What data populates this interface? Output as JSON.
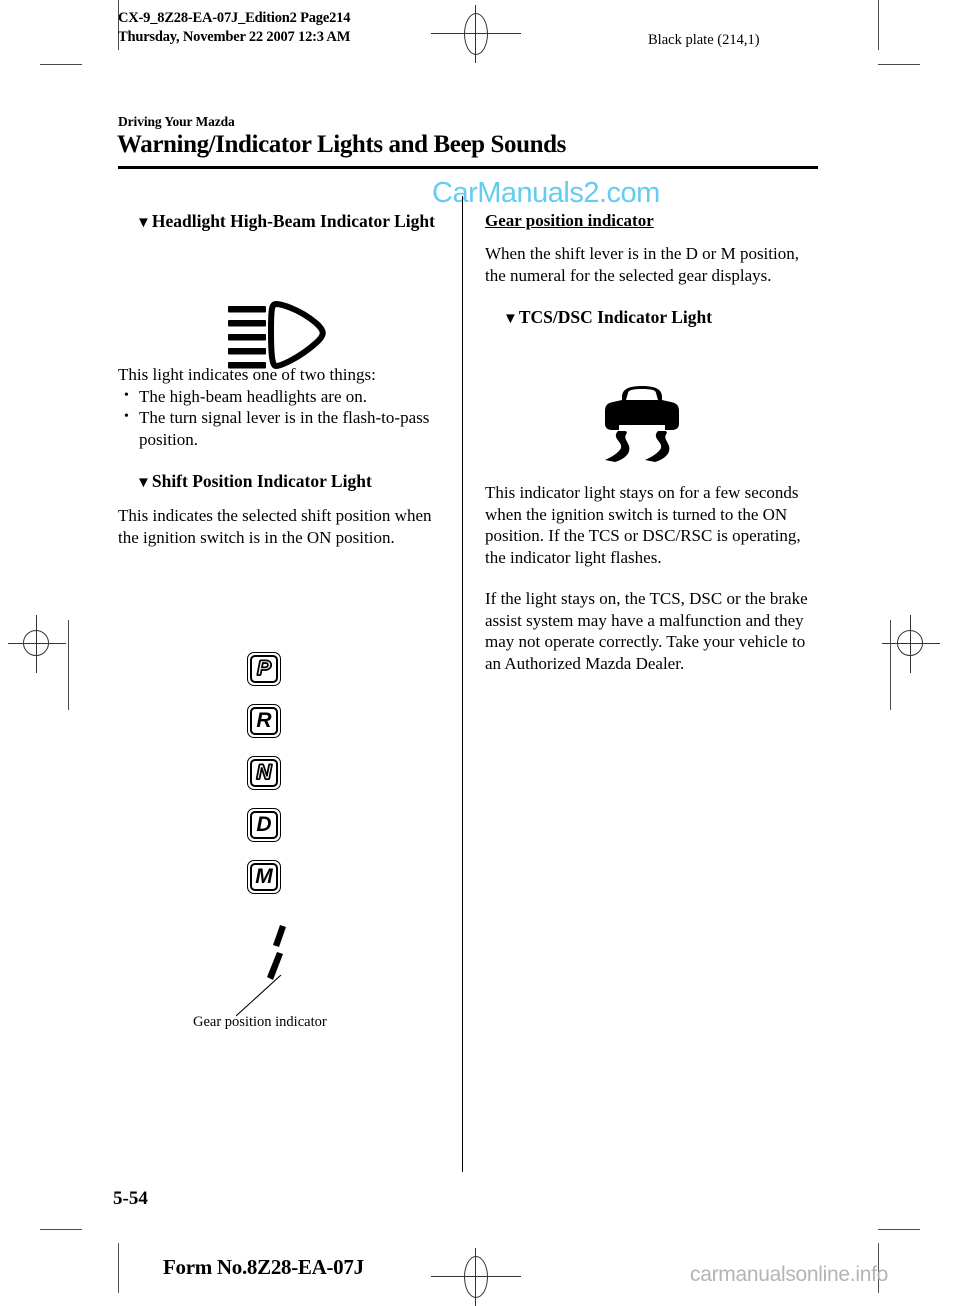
{
  "document": {
    "header": {
      "file_line1": "CX-9_8Z28-EA-07J_Edition2 Page214",
      "file_line2": "Thursday, November 22 2007 12:3 AM",
      "plate_note": "Black plate (214,1)"
    },
    "title": {
      "kicker": "Driving Your Mazda",
      "heading": "Warning/Indicator Lights and Beep Sounds"
    },
    "watermarks": {
      "top": "CarManuals2.com",
      "top_color": "#57c8f0",
      "bottom": "carmanualsonline.info",
      "bottom_color": "#b4b4b4"
    },
    "footer": {
      "page_number": "5-54",
      "form_number": "Form No.8Z28-EA-07J"
    }
  },
  "left_column": {
    "section1": {
      "bullet_glyph": "▼",
      "heading": "Headlight High-Beam Indicator Light",
      "figure_name": "high-beam-indicator-symbol",
      "intro": "This light indicates one of two things:",
      "bullets": [
        "The high-beam headlights are on.",
        "The turn signal lever is in the flash-to-pass position."
      ]
    },
    "section2": {
      "bullet_glyph": "▼",
      "heading": "Shift Position Indicator Light",
      "body": "This indicates the selected shift position when the ignition switch is in the ON position.",
      "gear_positions": [
        "P",
        "R",
        "N",
        "D",
        "M"
      ],
      "gear_position_styles": [
        "hollow",
        "solid",
        "hollow",
        "solid",
        "solid"
      ],
      "figure_caption": "Gear position indicator"
    }
  },
  "right_column": {
    "subsection1": {
      "heading": "Gear position indicator",
      "body": "When the shift lever is in the D or M position, the numeral for the selected gear displays."
    },
    "section3": {
      "bullet_glyph": "▼",
      "heading": "TCS/DSC Indicator Light",
      "figure_name": "tcs-dsc-skidding-car-symbol",
      "paragraph1": "This indicator light stays on for a few seconds when the ignition switch is turned to the ON position. If the TCS or DSC/RSC is operating, the indicator light flashes.",
      "paragraph2": "If the light stays on, the TCS, DSC or the brake assist system may have a malfunction and they may not operate correctly. Take your vehicle to an Authorized Mazda Dealer."
    }
  }
}
